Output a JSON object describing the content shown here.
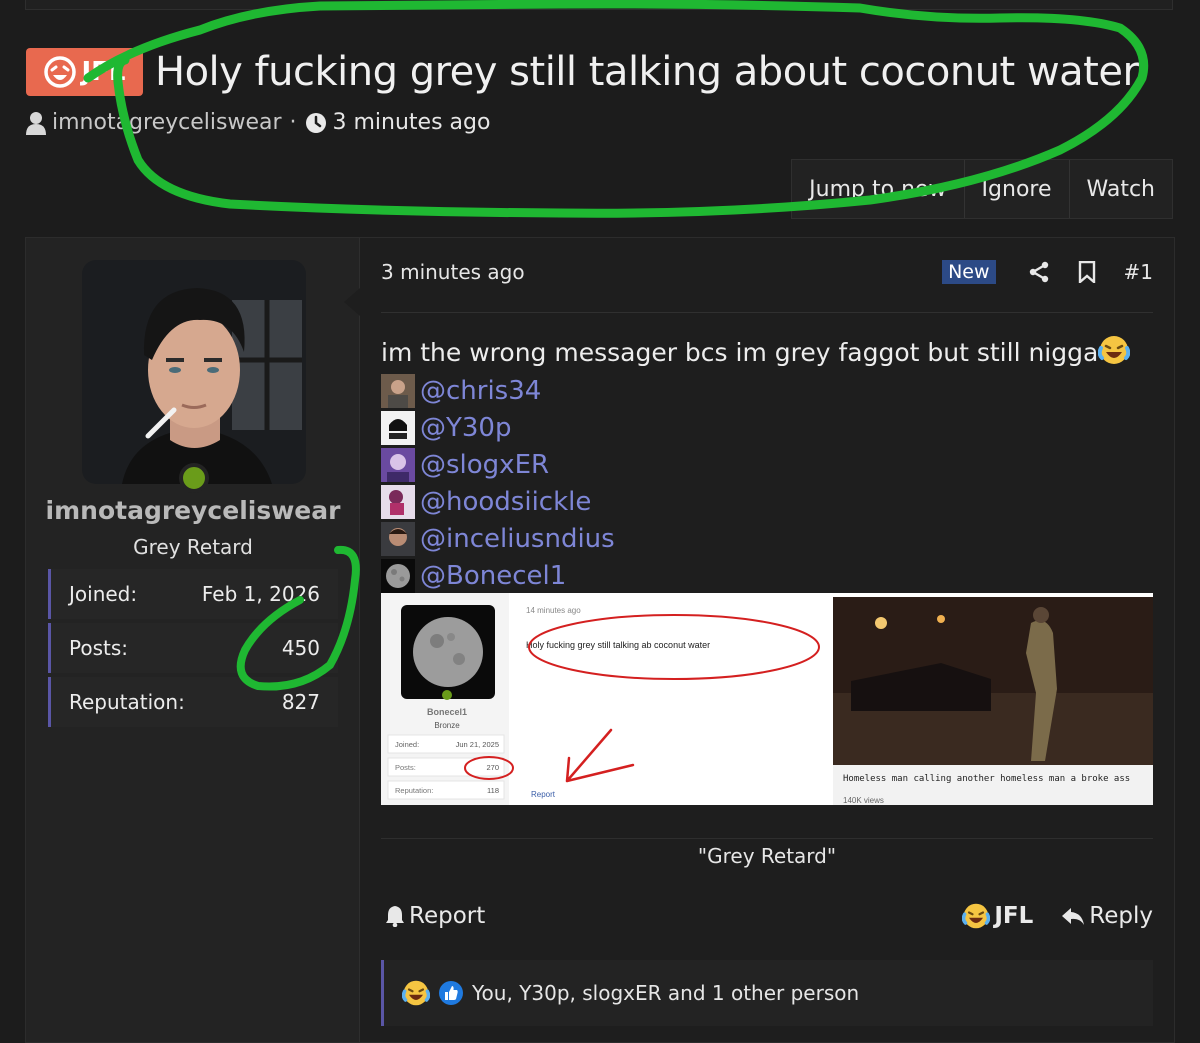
{
  "thread": {
    "prefix": "JFL",
    "title": "Holy fucking grey still talking about coconut water",
    "author": "imnotagreyceliswear",
    "time": "3 minutes ago"
  },
  "actions": {
    "jump": "Jump to new",
    "ignore": "Ignore",
    "watch": "Watch"
  },
  "user": {
    "name": "imnotagreyceliswear",
    "title": "Grey Retard",
    "stats": [
      {
        "label": "Joined:",
        "value": "Feb 1, 2026"
      },
      {
        "label": "Posts:",
        "value": "450"
      },
      {
        "label": "Reputation:",
        "value": "827"
      }
    ]
  },
  "post": {
    "time": "3 minutes ago",
    "badge": "New",
    "number": "#1",
    "text": "im the wrong messager bcs im grey faggot but still nigga",
    "mentions": [
      "@chris34",
      "@Y30p",
      "@slogxER",
      "@hoodsiickle",
      "@inceliusndius",
      "@Bonecel1"
    ],
    "signature": "\"Grey Retard\"",
    "report": "Report",
    "react": "JFL",
    "reply": "Reply",
    "reactions": "You, Y30p, slogxER and 1 other person"
  },
  "embed": {
    "time": "14 minutes ago",
    "quote": "Holy fucking grey still talking ab coconut water",
    "name": "Bonecel1",
    "rank": "Bronze",
    "stats": [
      {
        "label": "Joined:",
        "value": "Jun 21, 2025"
      },
      {
        "label": "Posts:",
        "value": "270"
      },
      {
        "label": "Reputation:",
        "value": "118"
      }
    ],
    "report": "Report",
    "video_caption": "Homeless man calling another homeless man a broke ass",
    "video_views": "140K views"
  },
  "colors": {
    "prefix": "#e8694f",
    "accent": "#5a56a6",
    "mention": "#7e86d6",
    "scribble_green": "#1fb832",
    "scribble_red": "#d42020"
  }
}
